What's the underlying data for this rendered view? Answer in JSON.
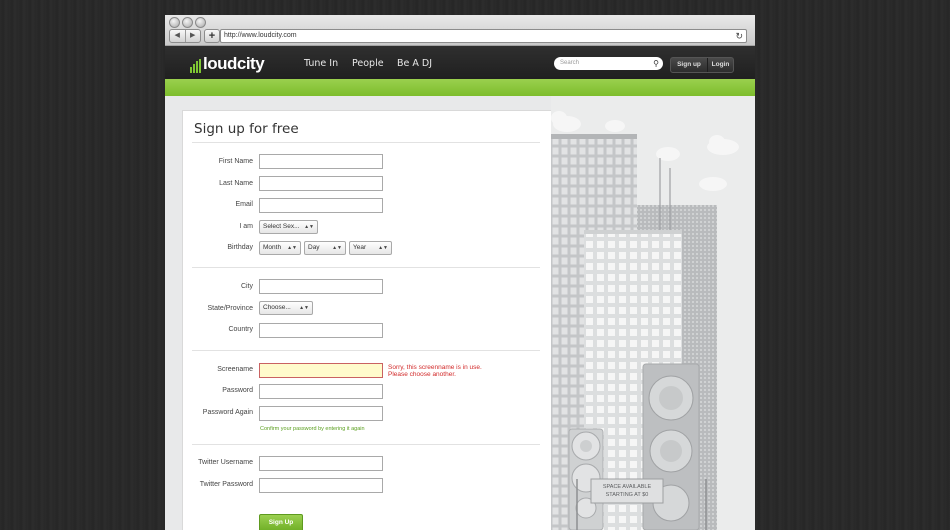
{
  "browser": {
    "url": "http://www.loudcity.com",
    "back_glyph": "◀",
    "forward_glyph": "▶",
    "add_glyph": "+",
    "reload_glyph": "↻"
  },
  "header": {
    "logo_text": "loudcity",
    "nav": [
      "Tune In",
      "People",
      "Be A DJ"
    ],
    "search_placeholder": "Search",
    "search_glyph": "⚲",
    "signup_label": "Sign up",
    "login_label": "Login"
  },
  "form": {
    "title": "Sign up for free",
    "labels": {
      "first_name": "First Name",
      "last_name": "Last Name",
      "email": "Email",
      "i_am": "I am",
      "birthday": "Birthday",
      "city": "City",
      "state": "State/Province",
      "country": "Country",
      "screename": "Screename",
      "password": "Password",
      "password_again": "Password Again",
      "twitter_username": "Twitter Username",
      "twitter_password": "Twitter Password"
    },
    "selects": {
      "sex": "Select Sex...",
      "month": "Month",
      "day": "Day",
      "year": "Year",
      "state": "Choose..."
    },
    "select_arrow": "▲▼",
    "error": {
      "line1": "Sorry, this screenname is in use.",
      "line2": "Please choose another."
    },
    "hint": "Confirm your password by entering it again",
    "submit_label": "Sign Up"
  },
  "ad": {
    "line1": "SPACE AVAILABLE",
    "line2": "STARTING AT $0"
  },
  "colors": {
    "brand_green": "#7dbd2c",
    "error_red": "#d22b2b",
    "hint_green": "#5a9f1e",
    "header_dark": "#262626"
  }
}
